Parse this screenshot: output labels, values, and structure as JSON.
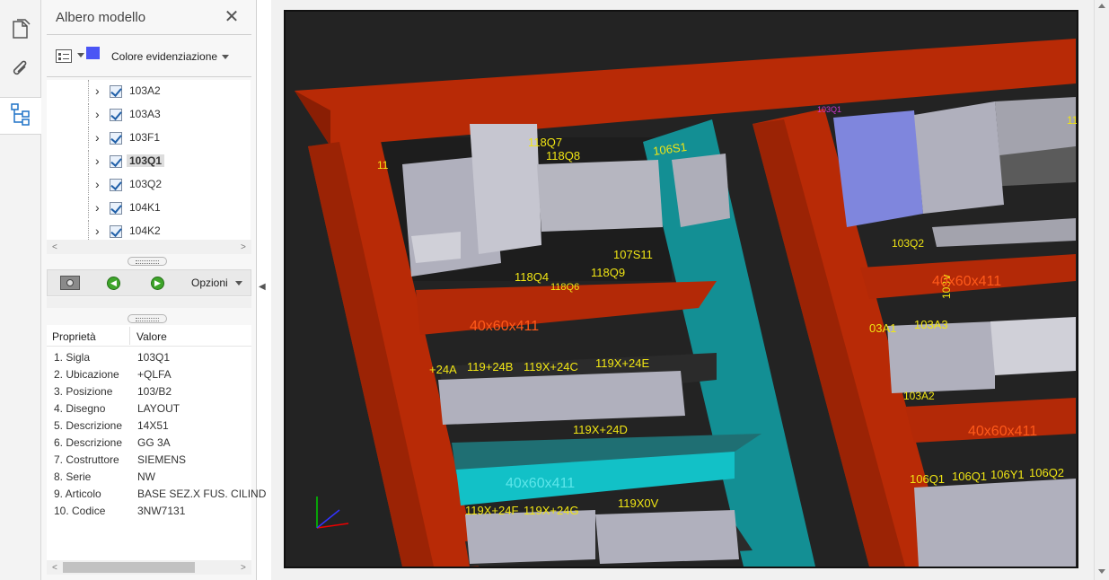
{
  "sidebar": {
    "icons": [
      "pages-icon",
      "attachment-icon",
      "model-tree-icon"
    ]
  },
  "panel": {
    "title": "Albero modello",
    "highlight_label": "Colore evidenziazione",
    "highlight_color": "#4a55f5",
    "tree_items": [
      {
        "label": "103A2",
        "checked": true
      },
      {
        "label": "103A3",
        "checked": true
      },
      {
        "label": "103F1",
        "checked": true
      },
      {
        "label": "103Q1",
        "checked": true,
        "selected": true
      },
      {
        "label": "103Q2",
        "checked": true
      },
      {
        "label": "104K1",
        "checked": true
      },
      {
        "label": "104K2",
        "checked": true
      }
    ],
    "options_label": "Opzioni",
    "props_header": {
      "name": "Proprietà",
      "value": "Valore"
    },
    "properties": [
      {
        "name": "1. Sigla",
        "value": "103Q1"
      },
      {
        "name": "2. Ubicazione",
        "value": "+QLFA"
      },
      {
        "name": "3. Posizione",
        "value": "103/B2"
      },
      {
        "name": "4. Disegno",
        "value": "LAYOUT"
      },
      {
        "name": "5. Descrizione",
        "value": "14X51"
      },
      {
        "name": "6. Descrizione",
        "value": "GG 3A"
      },
      {
        "name": "7. Costruttore",
        "value": "SIEMENS"
      },
      {
        "name": "8. Serie",
        "value": "NW"
      },
      {
        "name": "9. Articolo",
        "value": "BASE SEZ.X FUS. CILIND"
      },
      {
        "name": "10. Codice",
        "value": "3NW7131"
      }
    ]
  },
  "viewer": {
    "colors": {
      "frame": "#b82a06",
      "frame_dark": "#8a1e04",
      "rail": "#b32907",
      "teal": "#138f94",
      "teal_light": "#12c1c7",
      "device": "#b0b0bd",
      "label": "#f0e514",
      "highlight": "#7f86dd",
      "background": "#232323"
    },
    "labels": {
      "l118q7": "118Q7",
      "l118q8": "118Q8",
      "l106s1": "106S1",
      "l118q4": "118Q4",
      "l118q9": "118Q9",
      "l107s11": "107S11",
      "l118q6": "118Q6",
      "l103q1": "103Q1",
      "l103q2": "103Q2",
      "l103a1": "03A1",
      "l103a3": "103A3",
      "l103a2": "103A2",
      "l103v": "103∨",
      "l24a": "+24A",
      "l24b": "119+24B",
      "l24c": "119X+24C",
      "l24e": "119X+24E",
      "l24d": "119X+24D",
      "l24f": "119X+24F",
      "l24g": "119X+24G",
      "l0v": "119X0V",
      "l106q1": "106Q1",
      "l106q1b": "106Q1",
      "l106y1": "106Y1",
      "l106q2": "106Q2",
      "rail1": "40x60x411",
      "rail2": "40x60x411",
      "rail3": "40x60x411",
      "rail4": "40x60x411",
      "rail5": "40x60x411",
      "l11": "11",
      "l11b": "11"
    }
  }
}
